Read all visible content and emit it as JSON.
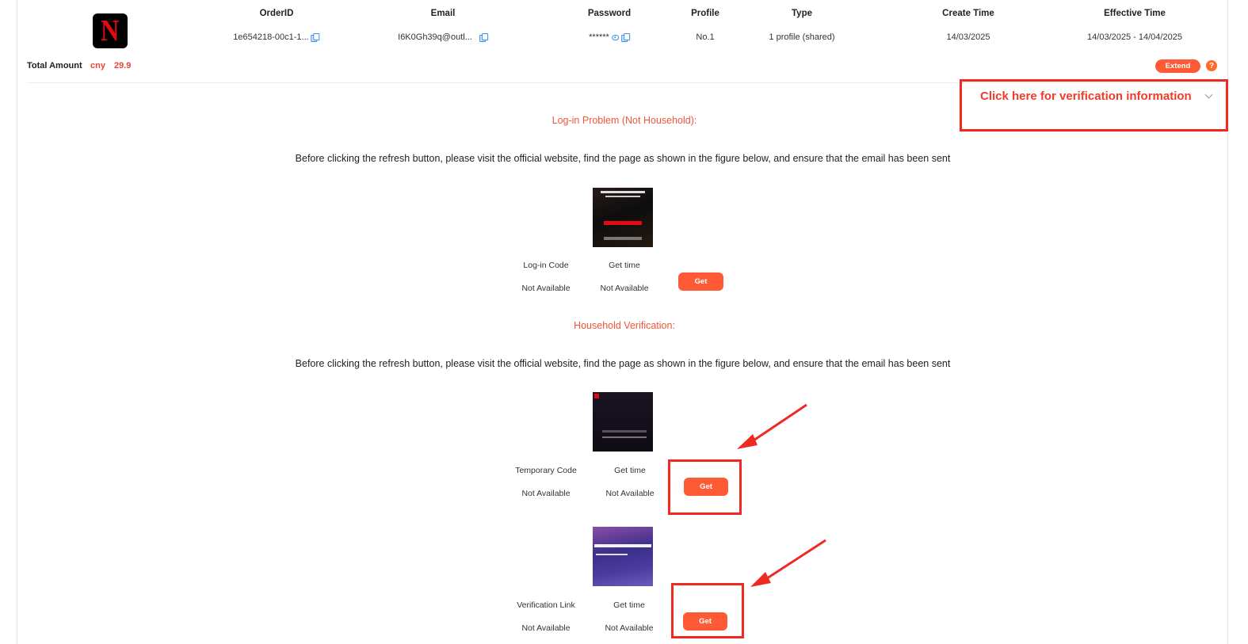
{
  "order": {
    "logo_letter": "N",
    "headers": {
      "order_id": "OrderID",
      "email": "Email",
      "password": "Password",
      "profile": "Profile",
      "type": "Type",
      "create_time": "Create Time",
      "effective_time": "Effective Time"
    },
    "values": {
      "order_id": "1e654218-00c1-1...",
      "email": "I6K0Gh39q@outl...",
      "password": "******",
      "profile": "No.1",
      "type": "1 profile (shared)",
      "create_time": "14/03/2025",
      "effective_time": "14/03/2025 - 14/04/2025"
    },
    "total_label": "Total Amount",
    "currency": "cny",
    "total_value": "29.9",
    "extend_label": "Extend",
    "help_symbol": "?"
  },
  "verification_toggle": {
    "label": "Click here for verification information"
  },
  "login_section": {
    "title": "Log-in Problem (Not Household):",
    "instruction": "Before clicking the refresh button, please visit the official website, find the page as shown in the figure below, and ensure that the email has been sent",
    "code_label": "Log-in Code",
    "time_label": "Get time",
    "code_value": "Not Available",
    "time_value": "Not Available",
    "button": "Get"
  },
  "household_section": {
    "title": "Household Verification:",
    "instruction": "Before clicking the refresh button, please visit the official website, find the page as shown in the figure below, and ensure that the email has been sent",
    "temp": {
      "code_label": "Temporary Code",
      "time_label": "Get time",
      "code_value": "Not Available",
      "time_value": "Not Available",
      "button": "Get"
    },
    "link": {
      "code_label": "Verification Link",
      "time_label": "Get time",
      "code_value": "Not Available",
      "time_value": "Not Available",
      "button": "Get"
    }
  },
  "colors": {
    "accent": "#ff5a36",
    "highlight": "#ee2a22",
    "section_title": "#f0553a",
    "copy_icon": "#3d8cf5"
  },
  "icons": [
    "netflix-logo",
    "copy-icon",
    "eye-icon",
    "help-icon",
    "chevron-down-icon",
    "arrow-annotation"
  ]
}
